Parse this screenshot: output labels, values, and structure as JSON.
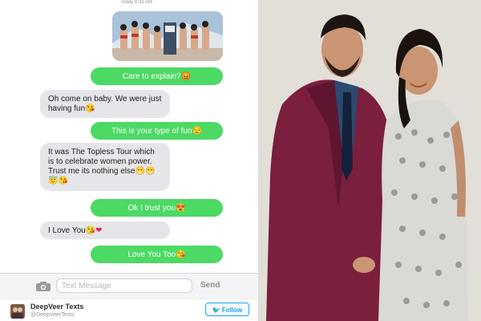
{
  "chat": {
    "timestamp": "Today 8:33 AM",
    "messages": [
      {
        "direction": "out",
        "text": "Care to explain?",
        "emoji": "😡"
      },
      {
        "direction": "in",
        "text": "Oh come on baby. We were just having fun",
        "emoji": "😘"
      },
      {
        "direction": "out",
        "text": "This is your type of fun",
        "emoji": "😒"
      },
      {
        "direction": "in",
        "text": "It was The Topless Tour which is to celebrate women power. Trust me its nothing else",
        "emoji": "😁😁😇😘"
      },
      {
        "direction": "out",
        "text": "Ok I trust you",
        "emoji": "😍"
      },
      {
        "direction": "in",
        "text": "I Love You",
        "emoji": "😘❤"
      },
      {
        "direction": "out",
        "text": "Love You Too",
        "emoji": "😘"
      }
    ],
    "input": {
      "placeholder": "Text Message",
      "send_label": "Send"
    }
  },
  "tweet": {
    "account_name": "DeepVeer Texts",
    "handle": "@DeepVeerTexts",
    "follow_label": "Follow"
  },
  "colors": {
    "outgoing_bubble": "#4cd964",
    "incoming_bubble": "#e5e5ea",
    "twitter_blue": "#1da1f2"
  }
}
